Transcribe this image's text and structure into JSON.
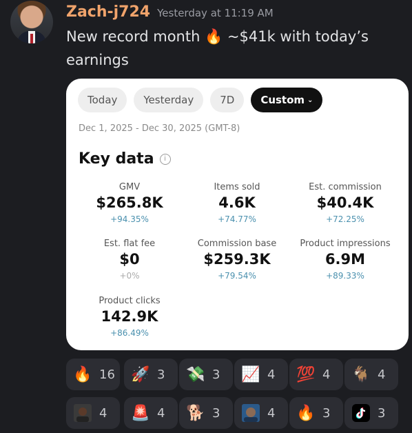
{
  "message": {
    "username": "Zach-j724",
    "timestamp": "Yesterday at 11:19 AM",
    "text": "New record month 🔥 ~$41k with today’s earnings"
  },
  "card": {
    "tabs": [
      {
        "label": "Today"
      },
      {
        "label": "Yesterday"
      },
      {
        "label": "7D"
      },
      {
        "label": "Custom"
      }
    ],
    "date_range": "Dec 1, 2025 - Dec 30, 2025 (GMT-8)",
    "section_title": "Key data",
    "metrics": [
      {
        "label": "GMV",
        "value": "$265.8K",
        "change": "+94.35%"
      },
      {
        "label": "Items sold",
        "value": "4.6K",
        "change": "+74.77%"
      },
      {
        "label": "Est. commission",
        "value": "$40.4K",
        "change": "+72.25%"
      },
      {
        "label": "Est. flat fee",
        "value": "$0",
        "change": "+0%"
      },
      {
        "label": "Commission base",
        "value": "$259.3K",
        "change": "+79.54%"
      },
      {
        "label": "Product impressions",
        "value": "6.9M",
        "change": "+89.33%"
      },
      {
        "label": "Product clicks",
        "value": "142.9K",
        "change": "+86.49%"
      }
    ]
  },
  "reactions": [
    {
      "emoji": "🔥",
      "icon": "fire-icon",
      "count": "16"
    },
    {
      "emoji": "🚀",
      "icon": "rocket-icon",
      "count": "3"
    },
    {
      "emoji": "💸",
      "icon": "money-with-wings-icon",
      "count": "3"
    },
    {
      "emoji": "📈",
      "icon": "chart-increasing-icon",
      "count": "4"
    },
    {
      "emoji": "💯",
      "icon": "hundred-points-icon",
      "count": "4"
    },
    {
      "emoji": "🐐",
      "icon": "goat-icon",
      "count": "4"
    },
    {
      "emoji": "",
      "icon": "custom-person-emoji-icon",
      "count": "4"
    },
    {
      "emoji": "🚨",
      "icon": "siren-icon",
      "count": "4"
    },
    {
      "emoji": "🐕",
      "icon": "dog-icon",
      "count": "3"
    },
    {
      "emoji": "",
      "icon": "custom-face-emoji-icon",
      "count": "4"
    },
    {
      "emoji": "🔥",
      "icon": "fire-icon",
      "count": "3"
    },
    {
      "emoji": "",
      "icon": "tiktok-logo-icon",
      "count": "3"
    }
  ]
}
